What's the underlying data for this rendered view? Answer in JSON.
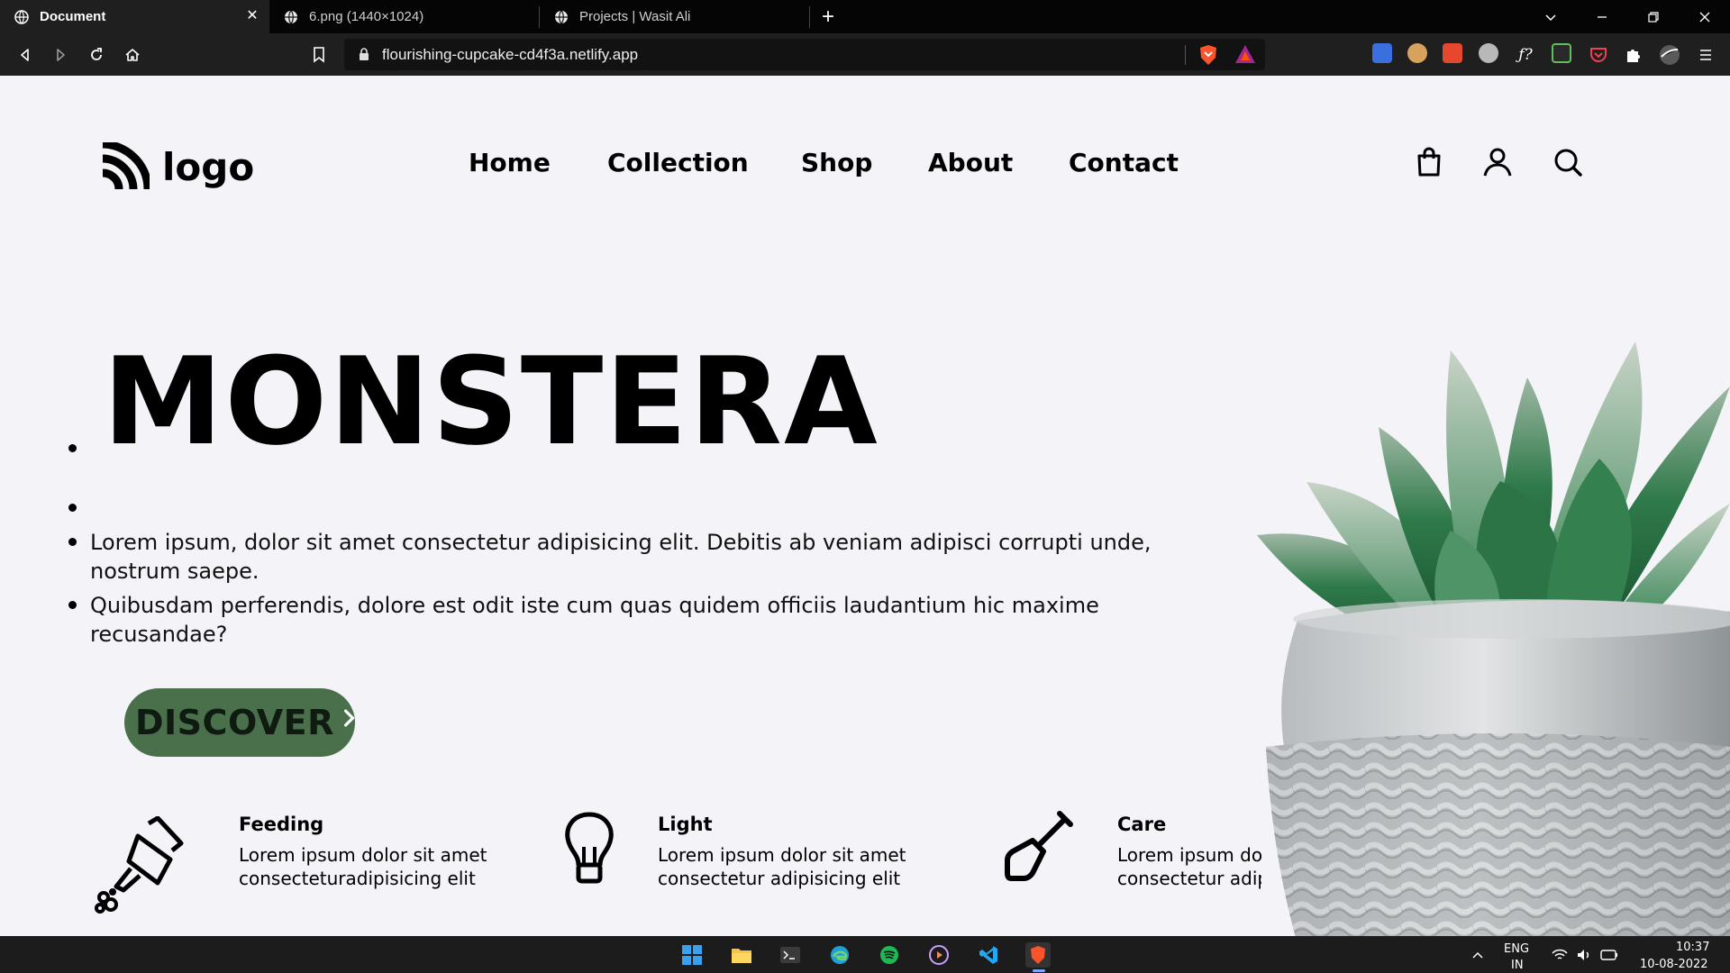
{
  "browser": {
    "tabs": [
      {
        "title": "Document",
        "active": true
      },
      {
        "title": "6.png (1440×1024)",
        "active": false
      },
      {
        "title": "Projects | Wasit Ali",
        "active": false
      }
    ],
    "new_tab_label": "+",
    "close_tab_label": "✕",
    "url": "flourishing-cupcake-cd4f3a.netlify.app"
  },
  "site": {
    "logo_text": "logo",
    "nav": [
      "Home",
      "Collection",
      "Shop",
      "About",
      "Contact"
    ],
    "hero": {
      "title": "MONSTERA",
      "paragraph1": "Lorem ipsum, dolor sit amet consectetur adipisicing elit. Debitis ab veniam adipisci corrupti unde, nostrum saepe.",
      "paragraph2": "Quibusdam perferendis, dolore est odit iste cum quas quidem officiis laudantium hic maxime recusandae?",
      "cta": "DISCOVER"
    },
    "features": [
      {
        "title": "Feeding",
        "line1": "Lorem ipsum dolor sit amet",
        "line2": "consecteturadipisicing elit",
        "icon": "watering-can-icon"
      },
      {
        "title": "Light",
        "line1": "Lorem ipsum dolor sit amet",
        "line2": "consectetur adipisicing elit",
        "icon": "lightbulb-icon"
      },
      {
        "title": "Care",
        "line1": "Lorem ipsum dolor sit amet",
        "line2": "consectetur adipisicing elit",
        "icon": "shovel-icon"
      }
    ],
    "colors": {
      "cta_bg": "#4a6f4b",
      "page_bg": "#f3f3f8"
    }
  },
  "taskbar": {
    "language": "ENG",
    "region": "IN",
    "time": "10:37",
    "date": "10-08-2022"
  }
}
